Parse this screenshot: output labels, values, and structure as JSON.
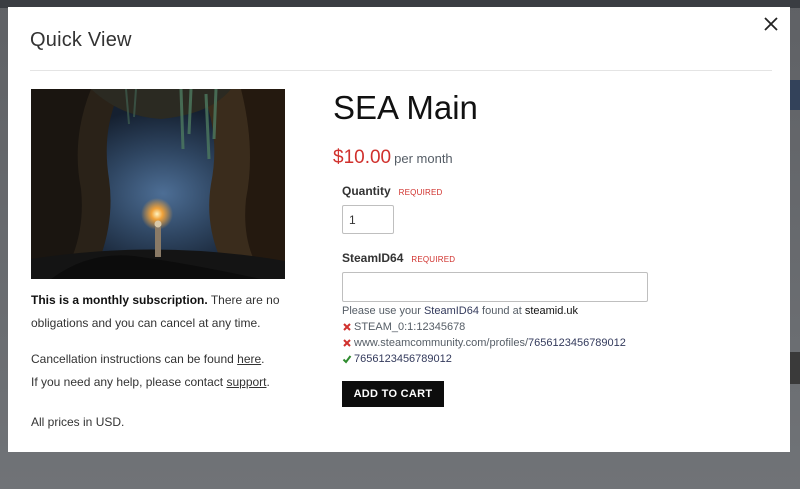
{
  "modal": {
    "title": "Quick View",
    "close_glyph": "×"
  },
  "product": {
    "title": "SEA Main",
    "price": "$10.00",
    "price_period": "per month",
    "image_icon": "cave-scene-image"
  },
  "description": {
    "subscription_bold": "This is a monthly subscription.",
    "subscription_rest": " There are no obligations and you can cancel at any time.",
    "cancel_prefix": "Cancellation instructions can be found ",
    "cancel_link": "here",
    "cancel_suffix": ".",
    "help_prefix": "If you need any help, please contact ",
    "help_link": "support",
    "help_suffix": ".",
    "currency_note": "All prices in USD."
  },
  "form": {
    "quantity_label": "Quantity",
    "quantity_required": "REQUIRED",
    "quantity_value": "1",
    "steamid_label": "SteamID64",
    "steamid_required": "REQUIRED",
    "steamid_value": "",
    "hint_prefix": "Please use your ",
    "hint_field": "SteamID64",
    "hint_middle": " found at ",
    "hint_site": "steamid.uk",
    "examples": [
      {
        "status": "invalid",
        "icon": "x-mark-icon",
        "plain": "STEAM_0:1:12345678",
        "strong": ""
      },
      {
        "status": "invalid",
        "icon": "x-mark-icon",
        "plain": "www.steamcommunity.com/profiles/",
        "strong": "7656123456789012"
      },
      {
        "status": "valid",
        "icon": "check-mark-icon",
        "plain": "",
        "strong": "7656123456789012"
      }
    ],
    "add_to_cart_label": "ADD TO CART"
  },
  "colors": {
    "price_red": "#d0312d",
    "required_red": "#d0312d",
    "invalid_red": "#d0312d",
    "valid_green": "#2e8b2e",
    "button_black": "#0d0d0d"
  }
}
